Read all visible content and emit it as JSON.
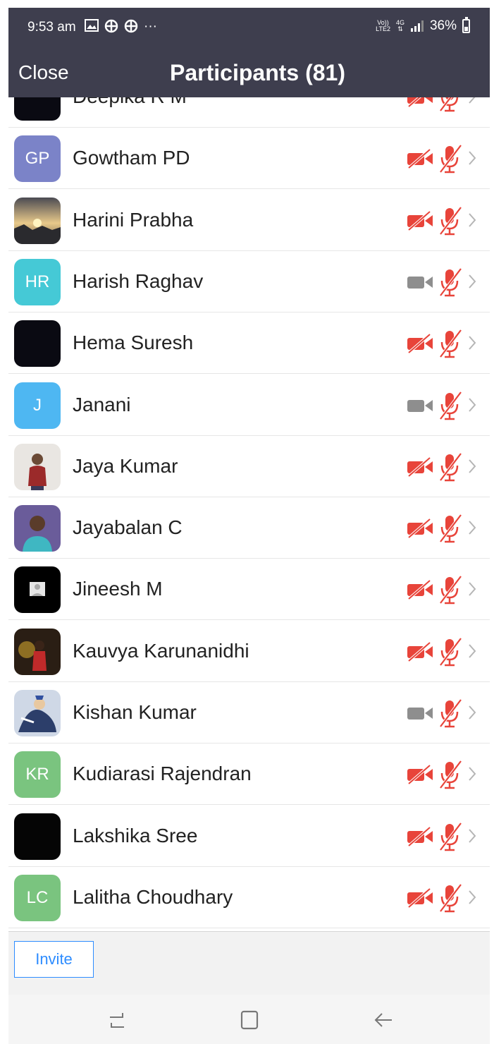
{
  "status_bar": {
    "time": "9:53 am",
    "notification_icons": [
      "gallery-icon",
      "grid-app-icon",
      "grid-app-icon",
      "more-dots-icon"
    ],
    "network_top": "Vo))",
    "network_bottom": "LTE2",
    "signal_type": "4G",
    "battery": "36%",
    "battery_level": 0.36
  },
  "header": {
    "close_label": "Close",
    "title": "Participants (81)"
  },
  "participants": [
    {
      "name": "Deepika R M",
      "avatar": {
        "type": "color",
        "color": "#0a0a12",
        "initials": ""
      },
      "video_on": false,
      "audio_on": false
    },
    {
      "name": "Gowtham PD",
      "avatar": {
        "type": "initials",
        "color": "#7b83c8",
        "initials": "GP"
      },
      "video_on": false,
      "audio_on": false
    },
    {
      "name": "Harini Prabha",
      "avatar": {
        "type": "photo",
        "subject": "sunset-landscape"
      },
      "video_on": false,
      "audio_on": false
    },
    {
      "name": "Harish Raghav",
      "avatar": {
        "type": "initials",
        "color": "#45c9d6",
        "initials": "HR"
      },
      "video_on": true,
      "audio_on": false
    },
    {
      "name": "Hema Suresh",
      "avatar": {
        "type": "color",
        "color": "#0a0a12",
        "initials": ""
      },
      "video_on": false,
      "audio_on": false
    },
    {
      "name": "Janani",
      "avatar": {
        "type": "initials",
        "color": "#4eb7f2",
        "initials": "J"
      },
      "video_on": true,
      "audio_on": false
    },
    {
      "name": "Jaya Kumar",
      "avatar": {
        "type": "photo",
        "subject": "person-red-shirt"
      },
      "video_on": false,
      "audio_on": false
    },
    {
      "name": "Jayabalan C",
      "avatar": {
        "type": "photo",
        "subject": "person-portrait"
      },
      "video_on": false,
      "audio_on": false
    },
    {
      "name": "Jineesh M",
      "avatar": {
        "type": "photo",
        "subject": "default-profile"
      },
      "video_on": false,
      "audio_on": false
    },
    {
      "name": "Kauvya Karunanidhi",
      "avatar": {
        "type": "photo",
        "subject": "dark-portrait"
      },
      "video_on": false,
      "audio_on": false
    },
    {
      "name": "Kishan Kumar",
      "avatar": {
        "type": "photo",
        "subject": "illustration"
      },
      "video_on": true,
      "audio_on": false
    },
    {
      "name": "Kudiarasi Rajendran",
      "avatar": {
        "type": "initials",
        "color": "#7ac47f",
        "initials": "KR"
      },
      "video_on": false,
      "audio_on": false
    },
    {
      "name": "Lakshika Sree",
      "avatar": {
        "type": "color",
        "color": "#050505",
        "initials": ""
      },
      "video_on": false,
      "audio_on": false
    },
    {
      "name": "Lalitha Choudhary",
      "avatar": {
        "type": "initials",
        "color": "#7ac47f",
        "initials": "LC"
      },
      "video_on": false,
      "audio_on": false
    }
  ],
  "footer": {
    "invite_label": "Invite"
  },
  "nav_bar": [
    "recent-apps-icon",
    "home-icon",
    "back-icon"
  ],
  "colors": {
    "header_bg": "#3e3e4e",
    "muted_red": "#e8443a",
    "video_on_gray": "#8e8e8e",
    "accent_blue": "#2d8cff"
  }
}
